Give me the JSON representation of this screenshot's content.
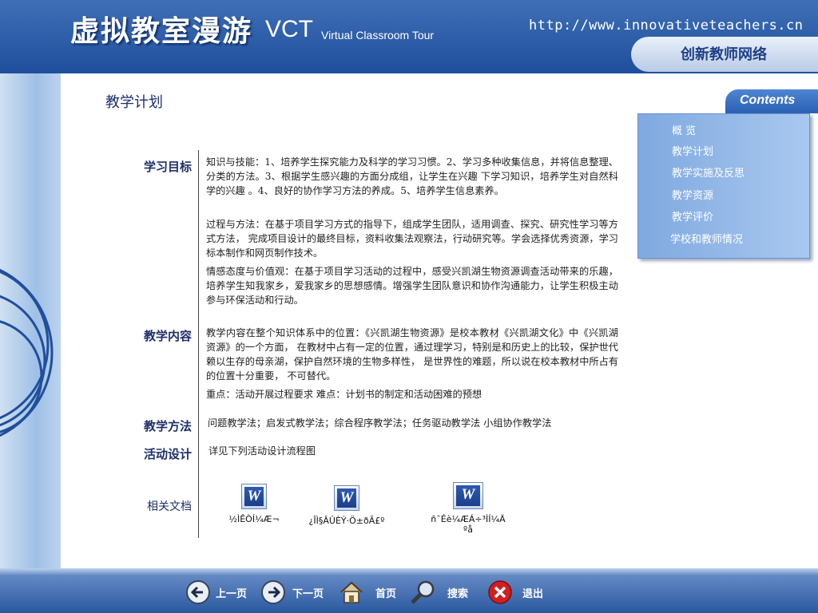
{
  "header": {
    "title_cn": "虚拟教室漫游",
    "title_vct": "VCT",
    "title_en": "Virtual Classroom Tour",
    "url": "http://www.innovativeteachers.cn",
    "site_name": "创新教师网络"
  },
  "page": {
    "title": "教学计划"
  },
  "sections": {
    "goals": {
      "label": "学习目标",
      "paragraphs": [
        "知识与技能：1、培养学生探究能力及科学的学习习惯。2、学习多种收集信息，并将信息整理、分类的方法。3、根据学生感兴趣的方面分成组，让学生在兴趣 下学习知识，培养学生对自然科学的兴趣 。4、良好的协作学习方法的养成。5、培养学生信息素养。",
        " 过程与方法：在基于项目学习方式的指导下，组成学生团队，适用调查、探究、研究性学习等方式方法， 完成项目设计的最终目标，资料收集法观察法，行动研究等。学会选择优秀资源，学习标本制作和网页制作技术。",
        " 情感态度与价值观：在基于项目学习活动的过程中，感受兴凯湖生物资源调查活动带来的乐趣，培养学生知我家乡，爱我家乡的思想感情。增强学生团队意识和协作沟通能力，让学生积极主动参与环保活动和行动。"
      ]
    },
    "content": {
      "label": "教学内容",
      "paragraphs": [
        "教学内容在整个知识体系中的位置：《兴凯湖生物资源》是校本教材《兴凯湖文化》中《兴凯湖资源》的一个方面， 在教材中占有一定的位置，通过理学习，特别是和历史上的比较，保护世代赖以生存的母亲湖，保护自然环境的生物多样性， 是世界性的难题，所以说在校本教材中所占有的位置十分重要， 不可替代。",
        "重点：活动开展过程要求  难点：计划书的制定和活动困难的预想"
      ]
    },
    "methods": {
      "label": "教学方法",
      "text": "问题教学法；启发式教学法；综合程序教学法；任务驱动教学法 小组协作教学法"
    },
    "activity": {
      "label": "活动设计",
      "text": "详见下列活动设计流程图"
    },
    "docs": {
      "label": "相关文档",
      "items": [
        {
          "icon": "word-document-icon",
          "icon_letter": "W",
          "name": "½ÌÊÒÍ¼Æ¬"
        },
        {
          "icon": "word-document-icon",
          "icon_letter": "W",
          "name": "¿ÎÌ§ÂÛÈÝ·Ö±ðÃ£º"
        },
        {
          "icon": "word-document-icon",
          "icon_letter": "W",
          "name_line1": "ñ¯Éè¼ÆÁ÷³ÌÍ¼Ä",
          "name_line2": "ºå"
        }
      ]
    }
  },
  "contents": {
    "tab": "Contents",
    "items": [
      "概  览",
      "教学计划",
      "教学实施及反思",
      "教学资源",
      "教学评价",
      "学校和教师情况"
    ]
  },
  "footer": {
    "prev": "上一页",
    "next": "下一页",
    "home": "首页",
    "search": "搜索",
    "exit": "退出"
  },
  "colors": {
    "header_blue": "#2a5aa8",
    "panel_blue": "#8fb5e8",
    "title_navy": "#1e2f6a"
  }
}
